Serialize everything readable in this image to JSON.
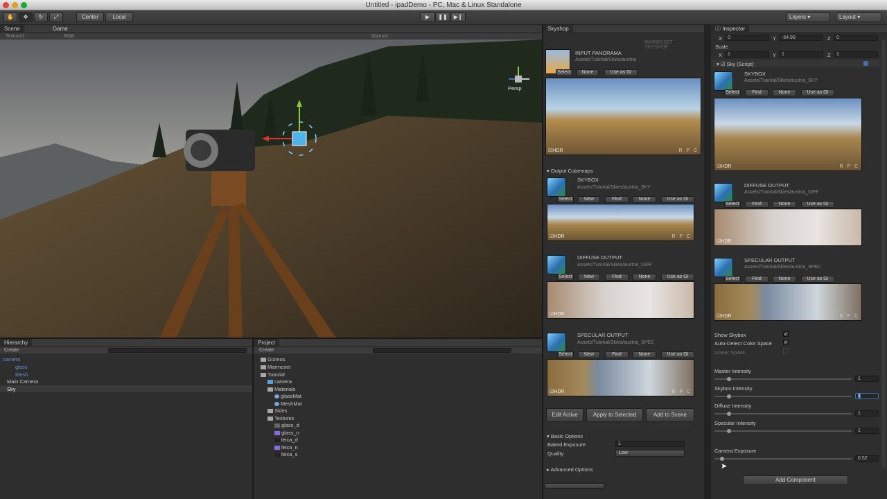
{
  "window": {
    "title": "Untitled - ipadDemo - PC, Mac & Linux Standalone"
  },
  "toolbar": {
    "center": "Center",
    "local": "Local",
    "layers": "Layers",
    "layout": "Layout"
  },
  "scene": {
    "tab_scene": "Scene",
    "tab_game": "Game",
    "mode": "Textured",
    "channel": "RGB",
    "gizmos": "Gizmos",
    "persp": "Persp"
  },
  "hierarchy": {
    "tab": "Hierarchy",
    "create": "Create",
    "items": [
      "camera",
      "glass",
      "Mesh",
      "Main Camera",
      "Sky"
    ]
  },
  "project": {
    "tab": "Project",
    "create": "Create",
    "items": [
      "Gizmos",
      "Marmoset",
      "Tutorial",
      "camera",
      "Materials",
      "glassMat",
      "MeshMat",
      "Skies",
      "Textures",
      "glass_d",
      "glass_n",
      "leica_d",
      "leica_n",
      "leica_s"
    ]
  },
  "skyshop": {
    "tab": "Skyshop",
    "logo": "MARMOSET SKYSHOP",
    "input_title": "INPUT PANORAMA",
    "input_path": "Assets/Tutorial/Skies/austria",
    "select": "Select",
    "none": "None",
    "use_gi": "Use as GI",
    "new": "New",
    "find": "Find",
    "hdr": "HDR",
    "rpc": "R P C",
    "output_cubemaps": "Output Cubemaps",
    "skybox_title": "SKYBOX",
    "skybox_path": "Assets/Tutorial/Skies/austria_SKY",
    "diffuse_title": "DIFFUSE OUTPUT",
    "diffuse_path": "Assets/Tutorial/Skies/austria_DIFF",
    "specular_title": "SPECULAR OUTPUT",
    "specular_path": "Assets/Tutorial/Skies/austria_SPEC",
    "edit_active": "Edit Active",
    "apply_selected": "Apply to Selected",
    "add_scene": "Add to Scene",
    "basic_options": "Basic Options",
    "baked_exposure": "Baked Exposure",
    "baked_exposure_value": "1",
    "quality": "Quality",
    "quality_value": "Low",
    "advanced_options": "Advanced Options"
  },
  "inspector": {
    "tab": "Inspector",
    "x_label": "X",
    "y_label": "Y",
    "z_label": "Z",
    "rot_x": "0",
    "rot_y": "-54.99",
    "rot_z": "0",
    "scale": "Scale",
    "scale_x": "1",
    "scale_y": "1",
    "scale_z": "1",
    "component": "Sky (Script)",
    "skybox_title": "SKYBOX",
    "skybox_path": "Assets/Tutorial/Skies/austria_SKY",
    "diffuse_title": "DIFFUSE OUTPUT",
    "diffuse_path": "Assets/Tutorial/Skies/austria_DIFF",
    "specular_title": "SPECULAR OUTPUT",
    "specular_path": "Assets/Tutorial/Skies/austria_SPEC",
    "select": "Select",
    "find": "Find",
    "none": "None",
    "use_gi": "Use as GI",
    "hdr": "HDR",
    "rpc": "R P C",
    "show_skybox": "Show Skybox",
    "auto_detect": "Auto-Detect Color Space",
    "linear_space": "Linear Space",
    "master_intensity": "Master Intensity",
    "master_value": "1",
    "skybox_intensity": "Skybox Intensity",
    "skybox_value": "1",
    "diffuse_intensity": "Diffuse Intensity",
    "diffuse_value": "1",
    "specular_intensity": "Specular Intensity",
    "specular_value": "1",
    "camera_exposure": "Camera Exposure",
    "camera_value": "0.52",
    "add_component": "Add Component"
  },
  "colors": {
    "accent": "#3d6ea8",
    "hierarchy_blue": "#6b8fd8"
  }
}
